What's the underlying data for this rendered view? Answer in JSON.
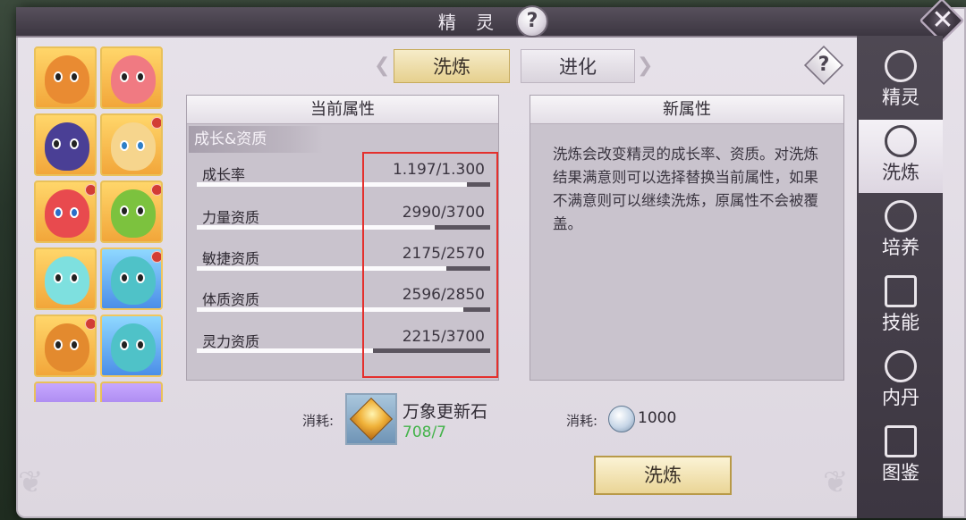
{
  "window": {
    "title": "精 灵",
    "help_glyph": "?",
    "close_glyph": "✕"
  },
  "tabs": [
    {
      "label": "洗炼",
      "active": true
    },
    {
      "label": "进化",
      "active": false
    }
  ],
  "panel_help_glyph": "?",
  "current_attr": {
    "header": "当前属性",
    "section": "成长&资质",
    "rows": [
      {
        "name": "成长率",
        "value": "1.197/1.300",
        "progress": 0.92
      },
      {
        "name": "力量资质",
        "value": "2990/3700",
        "progress": 0.81
      },
      {
        "name": "敏捷资质",
        "value": "2175/2570",
        "progress": 0.85
      },
      {
        "name": "体质资质",
        "value": "2596/2850",
        "progress": 0.91
      },
      {
        "name": "灵力资质",
        "value": "2215/3700",
        "progress": 0.6
      }
    ]
  },
  "new_attr": {
    "header": "新属性",
    "description": "洗炼会改变精灵的成长率、资质。对洗炼结果满意则可以选择替换当前属性，如果不满意则可以继续洗炼，原属性不会被覆盖。"
  },
  "cost": {
    "item_label": "消耗:",
    "item_name": "万象更新石",
    "item_count": "708/7",
    "coin_label": "消耗:",
    "coin_amount": "1000"
  },
  "action_button": "洗炼",
  "sidebar": [
    {
      "label": "精灵",
      "icon": "sprite-ring-icon",
      "active": false
    },
    {
      "label": "洗炼",
      "icon": "refine-flame-icon",
      "active": true
    },
    {
      "label": "培养",
      "icon": "cultivate-ring-icon",
      "active": false
    },
    {
      "label": "技能",
      "icon": "skill-book-icon",
      "active": false
    },
    {
      "label": "内丹",
      "icon": "inner-core-icon",
      "active": false
    },
    {
      "label": "图鉴",
      "icon": "atlas-book-icon",
      "active": false
    }
  ],
  "colors": {
    "accent_gold": "#e6d08e",
    "highlight_red": "#e4302d",
    "count_green": "#43b34a"
  }
}
